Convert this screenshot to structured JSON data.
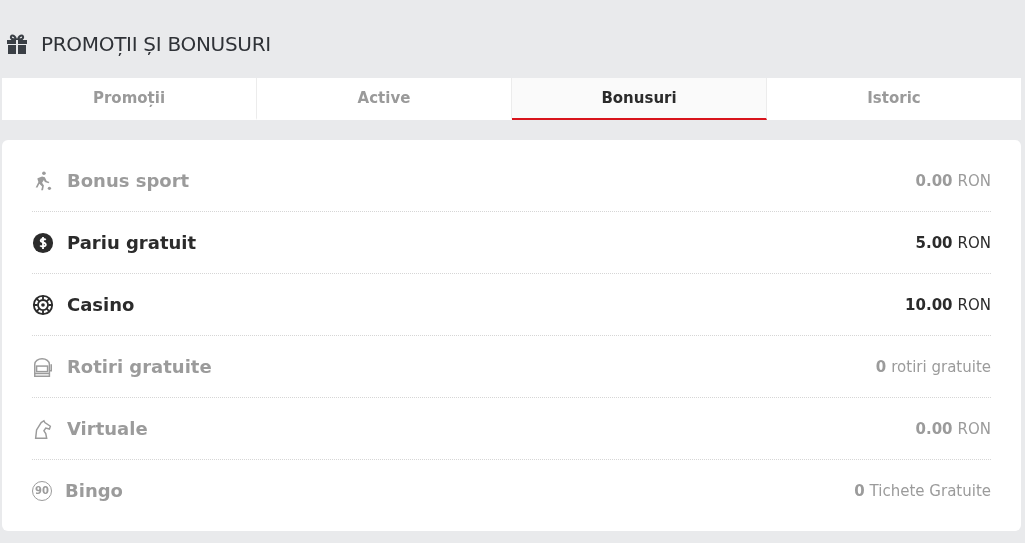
{
  "header": {
    "title": "PROMOȚII ȘI BONUSURI"
  },
  "tabs": [
    {
      "label": "Promoții",
      "selected": false
    },
    {
      "label": "Active",
      "selected": false
    },
    {
      "label": "Bonusuri",
      "selected": true
    },
    {
      "label": "Istoric",
      "selected": false
    }
  ],
  "bonuses": [
    {
      "kind": "sport",
      "name": "Bonus sport",
      "amount": "0.00",
      "unit": "RON",
      "disabled": true
    },
    {
      "kind": "coin",
      "name": "Pariu gratuit",
      "amount": "5.00",
      "unit": "RON",
      "disabled": false
    },
    {
      "kind": "chip",
      "name": "Casino",
      "amount": "10.00",
      "unit": "RON",
      "disabled": false
    },
    {
      "kind": "slot",
      "name": "Rotiri gratuite",
      "amount": "0",
      "unit": "rotiri gratuite",
      "disabled": true
    },
    {
      "kind": "horse",
      "name": "Virtuale",
      "amount": "0.00",
      "unit": "RON",
      "disabled": true
    },
    {
      "kind": "ball",
      "badge": "90",
      "name": "Bingo",
      "amount": "0",
      "unit": "Tichete Gratuite",
      "disabled": true
    }
  ]
}
